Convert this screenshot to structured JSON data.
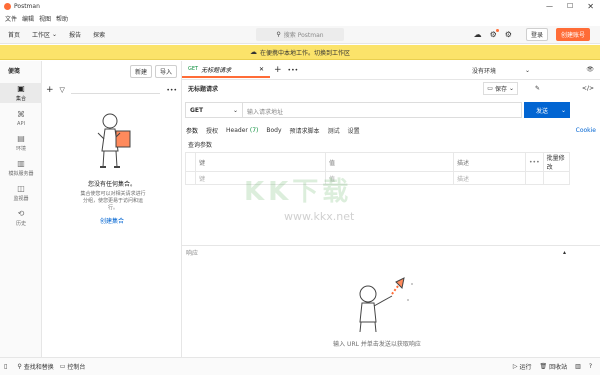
{
  "window": {
    "title": "Postman"
  },
  "menu": [
    "文件",
    "编辑",
    "视图",
    "帮助"
  ],
  "header": {
    "nav": [
      "首页",
      "工作区",
      "报告",
      "探索"
    ],
    "search_placeholder": "搜索 Postman",
    "login_label": "登录",
    "create_account_label": "创建账号"
  },
  "banner": {
    "text": "在便携中本地工作。切换到工作区"
  },
  "sidebar": {
    "title": "便笺",
    "new_label": "新建",
    "import_label": "导入",
    "rail": [
      {
        "label": "集合",
        "icon": "collections-icon"
      },
      {
        "label": "API",
        "icon": "api-icon"
      },
      {
        "label": "环境",
        "icon": "environments-icon"
      },
      {
        "label": "模拟服务器",
        "icon": "mock-server-icon"
      },
      {
        "label": "监视器",
        "icon": "monitor-icon"
      },
      {
        "label": "历史",
        "icon": "history-icon"
      }
    ],
    "empty_title": "您没有任何集合。",
    "empty_desc": "集合使您可以对相关请求进行分组，使您更易于访问和运行。",
    "create_collection_label": "创建集合"
  },
  "tabs": {
    "active": {
      "method": "GET",
      "title": "无标题请求"
    },
    "environment_select": "没有环境"
  },
  "request": {
    "title": "无标题请求",
    "save_label": "保存",
    "method": "GET",
    "url_placeholder": "输入请求地址",
    "send_label": "发送",
    "subtabs": [
      "参数",
      "授权",
      "Header",
      "Body",
      "预请求脚本",
      "测试",
      "设置"
    ],
    "header_count": "(7)",
    "cookie_label": "Cookie",
    "query_params_label": "查询参数",
    "table": {
      "headers": [
        "键",
        "值",
        "描述",
        "•••",
        "批量修改"
      ],
      "row": {
        "key": "键",
        "value": "值",
        "desc": "描述"
      }
    }
  },
  "response": {
    "label": "响应",
    "hint": "输入 URL 并单击发送以获取响应"
  },
  "watermark": {
    "logo": "KK下载",
    "url": "www.kkx.net"
  },
  "statusbar": {
    "find_replace": "查找和替换",
    "console": "控制台",
    "runner": "运行",
    "trash": "回收站"
  },
  "colors": {
    "accent": "#ff6c37",
    "send": "#0265d2",
    "banner": "#fbe36a"
  }
}
